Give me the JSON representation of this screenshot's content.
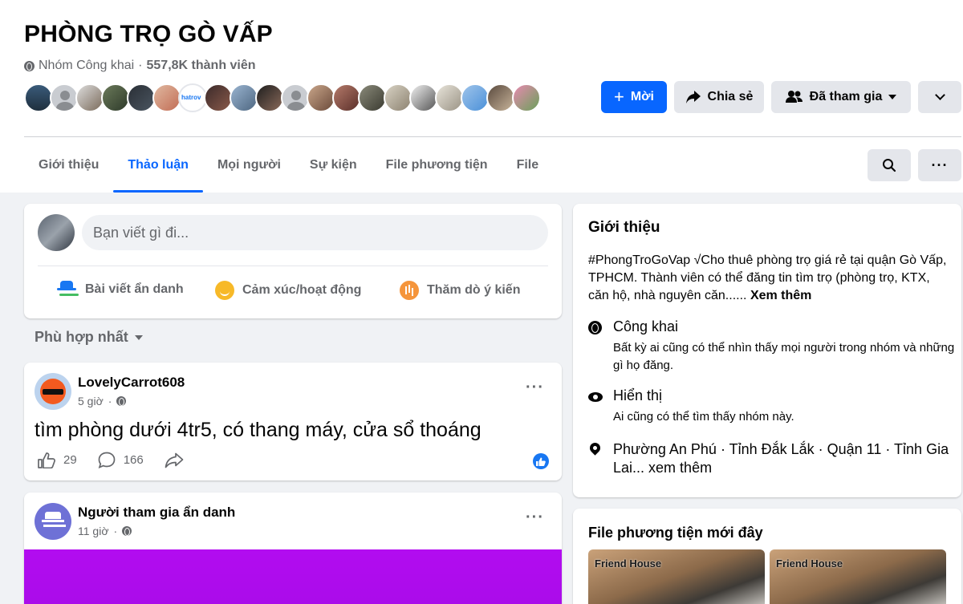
{
  "group": {
    "title": "PHÒNG TRỌ GÒ VẤP",
    "privacy": "Nhóm Công khai",
    "separator": "·",
    "members": "557,8K thành viên",
    "avatar_tag": "hatrov"
  },
  "header_buttons": {
    "invite": "Mời",
    "share": "Chia sẻ",
    "joined": "Đã tham gia"
  },
  "tabs": [
    "Giới thiệu",
    "Thảo luận",
    "Mọi người",
    "Sự kiện",
    "File phương tiện",
    "File"
  ],
  "active_tab": "Thảo luận",
  "composer": {
    "placeholder": "Bạn viết gì đi...",
    "actions": [
      "Bài viết ẩn danh",
      "Cảm xúc/hoạt động",
      "Thăm dò ý kiến"
    ]
  },
  "sort": "Phù hợp nhất",
  "posts": [
    {
      "author": "LovelyCarrot608",
      "time": "5 giờ",
      "text": "tìm phòng dưới 4tr5, có thang máy, cửa sổ thoáng",
      "likes": "29",
      "comments": "166"
    },
    {
      "author": "Người tham gia ẩn danh",
      "time": "11 giờ"
    }
  ],
  "about": {
    "title": "Giới thiệu",
    "description": "#PhongTroGoVap √Cho thuê phòng trọ giá rẻ tại quận Gò Vấp, TPHCM. Thành viên có thể đăng tin tìm trọ (phòng trọ, KTX, căn hộ, nhà nguyên căn......",
    "see_more": "Xem thêm",
    "public_title": "Công khai",
    "public_desc": "Bất kỳ ai cũng có thể nhìn thấy mọi người trong nhóm và những gì họ đăng.",
    "visible_title": "Hiển thị",
    "visible_desc": "Ai cũng có thể tìm thấy nhóm này.",
    "location": "Phường An Phú · Tỉnh Đắk Lắk · Quận 11 · Tỉnh Gia Lai...",
    "location_more": "xem thêm"
  },
  "media": {
    "title": "File phương tiện mới đây",
    "thumb_label": "Friend House"
  },
  "colors": {
    "accent": "#0866ff",
    "post_media": "#b20cf0"
  }
}
